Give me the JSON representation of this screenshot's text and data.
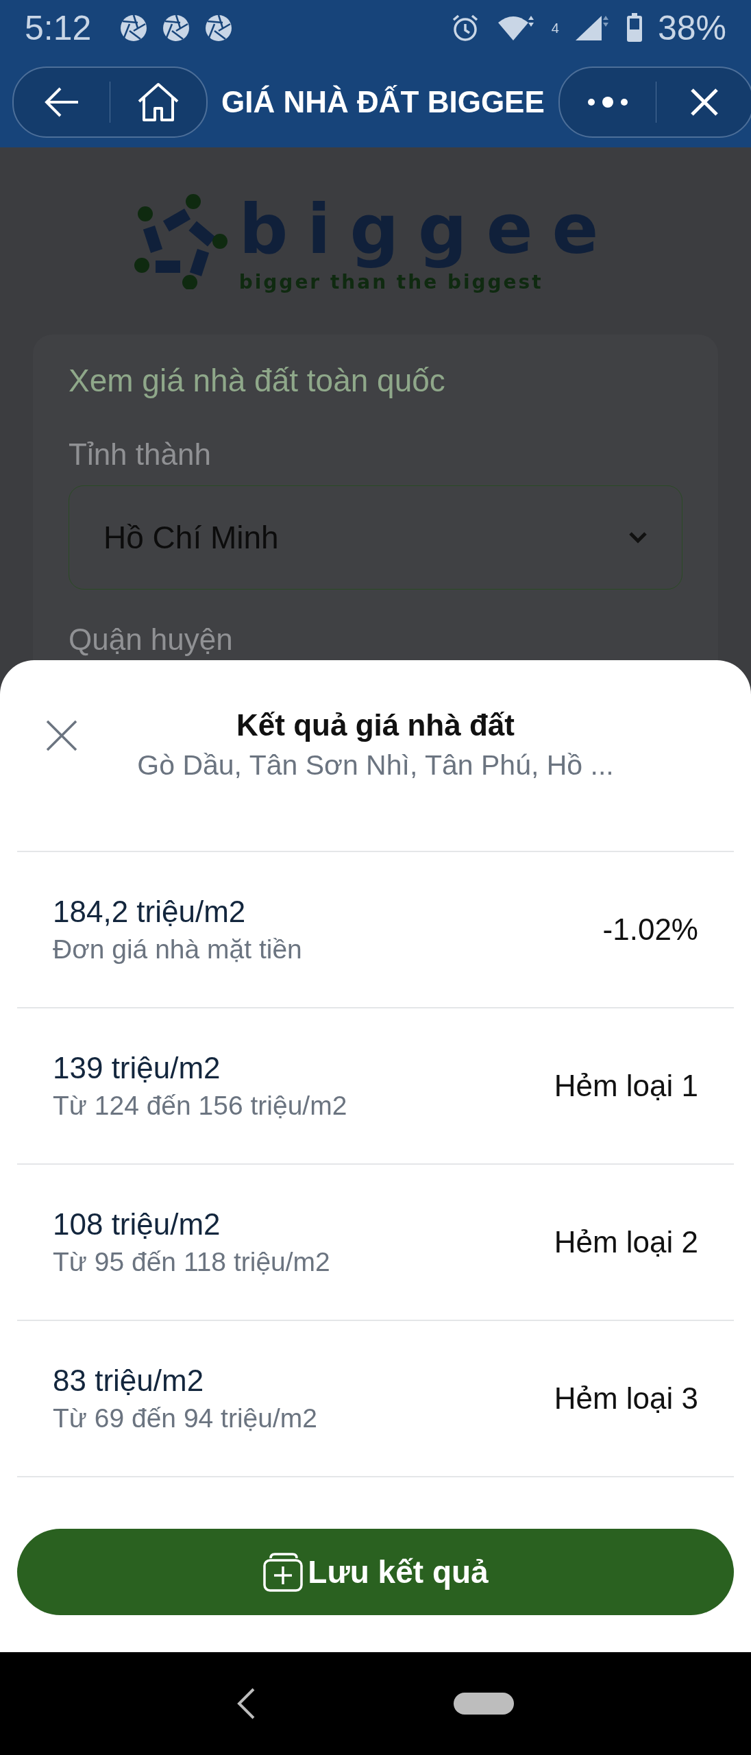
{
  "status_bar": {
    "time": "5:12",
    "network": "4",
    "battery": "38%"
  },
  "top_bar": {
    "title": "GIÁ NHÀ ĐẤT BIGGEE"
  },
  "logo": {
    "name": "biggee",
    "slogan": "bigger than the biggest"
  },
  "form": {
    "heading": "Xem giá nhà đất toàn quốc",
    "fields": [
      {
        "label": "Tỉnh thành",
        "value": "Hồ Chí Minh"
      }
    ],
    "next_label": "Quận huyện"
  },
  "sheet": {
    "title": "Kết quả giá nhà đất",
    "subtitle": "Gò Dầu, Tân Sơn Nhì, Tân Phú, Hồ ...",
    "results": [
      {
        "price": "184,2 triệu/m2",
        "detail": "Đơn giá nhà mặt tiền",
        "tag": "-1.02%"
      },
      {
        "price": "139 triệu/m2",
        "detail": "Từ 124 đến 156 triệu/m2",
        "tag": "Hẻm loại 1"
      },
      {
        "price": "108 triệu/m2",
        "detail": "Từ 95 đến 118 triệu/m2",
        "tag": "Hẻm loại 2"
      },
      {
        "price": "83 triệu/m2",
        "detail": "Từ 69 đến 94 triệu/m2",
        "tag": "Hẻm loại 3"
      }
    ],
    "save_button": "Lưu kết quả"
  }
}
